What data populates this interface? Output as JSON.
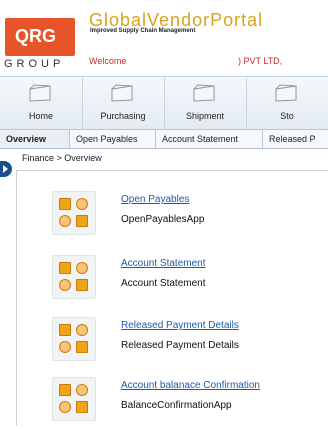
{
  "header": {
    "logo_text": "QRG",
    "group_text": "GROUP",
    "portal_title": "GlobalVendorPortal",
    "tagline": "Improved Supply Chain Management",
    "welcome": "Welcome",
    "company": ") PVT LTD,"
  },
  "nav": {
    "items": [
      {
        "label": "Home"
      },
      {
        "label": "Purchasing"
      },
      {
        "label": "Shipment"
      },
      {
        "label": "Sto"
      }
    ]
  },
  "tabs": [
    {
      "label": "Overview"
    },
    {
      "label": "Open Payables"
    },
    {
      "label": "Account Statement"
    },
    {
      "label": "Released P"
    }
  ],
  "breadcrumb": "Finance  >  Overview",
  "apps": [
    {
      "title": "Open Payables",
      "subtitle": "OpenPayablesApp"
    },
    {
      "title": "Account Statement",
      "subtitle": "Account Statement"
    },
    {
      "title": "Released Payment Details",
      "subtitle": "Released Payment Details"
    },
    {
      "title": "Account balanace Confirmation",
      "subtitle": "BalanceConfirmationApp"
    }
  ],
  "colors": {
    "accent_orange": "#e8542a",
    "portal_gold": "#d9a31b",
    "link_blue": "#1f5aa8",
    "welcome_red": "#d0282d"
  }
}
